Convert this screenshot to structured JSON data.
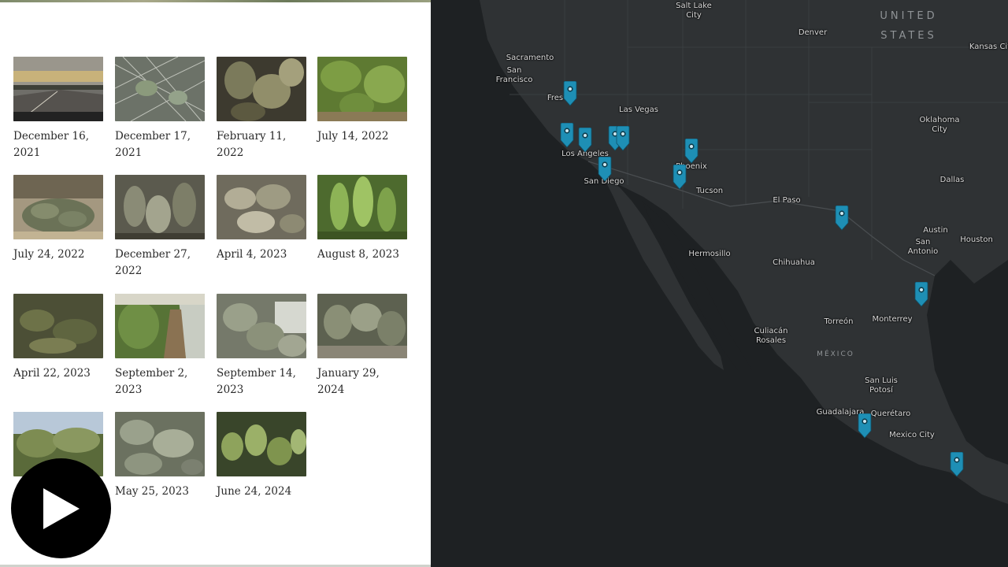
{
  "gallery": {
    "items": [
      {
        "date": "December 16, 2021",
        "photo": "desert-road-sunset"
      },
      {
        "date": "December 17, 2021",
        "photo": "cactus-spines"
      },
      {
        "date": "February 11, 2022",
        "photo": "prickly-pear-closeup"
      },
      {
        "date": "July 14, 2022",
        "photo": "green-cactus-pads"
      },
      {
        "date": "July 24, 2022",
        "photo": "drooping-cactus-pads"
      },
      {
        "date": "December 27, 2022",
        "photo": "dry-cactus-cluster"
      },
      {
        "date": "April 4, 2023",
        "photo": "pale-cactus-pads"
      },
      {
        "date": "August 8, 2023",
        "photo": "tall-green-cactus"
      },
      {
        "date": "April 22, 2023",
        "photo": "wilted-cactus"
      },
      {
        "date": "September 2, 2023",
        "photo": "sidewalk-cactus"
      },
      {
        "date": "September 14, 2023",
        "photo": "hillside-cactus"
      },
      {
        "date": "January 29, 2024",
        "photo": "cactus-fence"
      },
      {
        "date": "",
        "photo": "cactus-hedge-sky"
      },
      {
        "date": "May 25, 2023",
        "photo": "pale-cactus-leaves"
      },
      {
        "date": "June 24, 2024",
        "photo": "cactus-garden"
      }
    ]
  },
  "player": {
    "play_icon": "play-icon"
  },
  "map": {
    "region_labels": {
      "united": "UNITED",
      "states": "STATES",
      "mexico": "MÉXICO"
    },
    "cities": [
      {
        "id": "salt-lake",
        "name": "Salt Lake City"
      },
      {
        "id": "denver",
        "name": "Denver"
      },
      {
        "id": "kansas",
        "name": "Kansas Cit"
      },
      {
        "id": "sacramento",
        "name": "Sacramento"
      },
      {
        "id": "sf",
        "name": "San Francisco"
      },
      {
        "id": "fresno",
        "name": "Fres"
      },
      {
        "id": "las-vegas",
        "name": "Las Vegas"
      },
      {
        "id": "oklahoma",
        "name": "Oklahoma City"
      },
      {
        "id": "la",
        "name": "Los Angeles"
      },
      {
        "id": "phoenix",
        "name": "Phoenix"
      },
      {
        "id": "san-diego",
        "name": "San Diego"
      },
      {
        "id": "tucson",
        "name": "Tucson"
      },
      {
        "id": "dallas",
        "name": "Dallas"
      },
      {
        "id": "el-paso",
        "name": "El Paso"
      },
      {
        "id": "austin",
        "name": "Austin"
      },
      {
        "id": "houston",
        "name": "Houston"
      },
      {
        "id": "san-antonio",
        "name": "San Antonio"
      },
      {
        "id": "hermosillo",
        "name": "Hermosillo"
      },
      {
        "id": "chihuahua",
        "name": "Chihuahua"
      },
      {
        "id": "monterrey",
        "name": "Monterrey"
      },
      {
        "id": "torreon",
        "name": "Torreón"
      },
      {
        "id": "culiacan",
        "name": "Culiacán Rosales"
      },
      {
        "id": "slp",
        "name": "San Luis Potosí"
      },
      {
        "id": "guadalajara",
        "name": "Guadalajara"
      },
      {
        "id": "queretaro",
        "name": "Querétaro"
      },
      {
        "id": "mexico-city",
        "name": "Mexico City"
      }
    ],
    "pin_icon": "location-pin-icon",
    "pin_color": "#1e8fb5",
    "land_color": "#2e3133",
    "water_color": "#1e2123"
  }
}
